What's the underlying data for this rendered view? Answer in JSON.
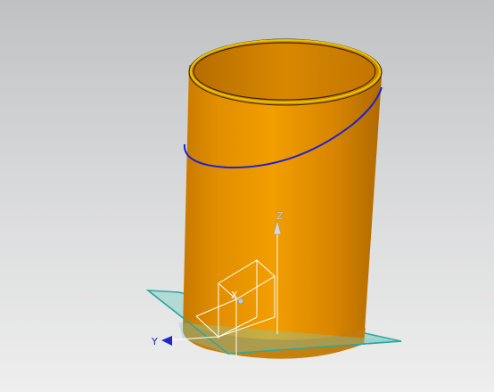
{
  "viewport": {
    "background_top": "#bfc1c3",
    "background_bottom": "#eeeeee"
  },
  "model": {
    "body_color": "#de8a00",
    "body_highlight": "#f3a000",
    "body_shadow": "#b56c00",
    "rim_color": "#e8c400",
    "section_curve_color": "#1a20d8",
    "datum_plane_color": "#36b3ad"
  },
  "triad": {
    "color": "#ffffff",
    "z_label": "Z",
    "y_label": "Y",
    "x_label": "X",
    "arrow_color": "#1f27c9"
  }
}
